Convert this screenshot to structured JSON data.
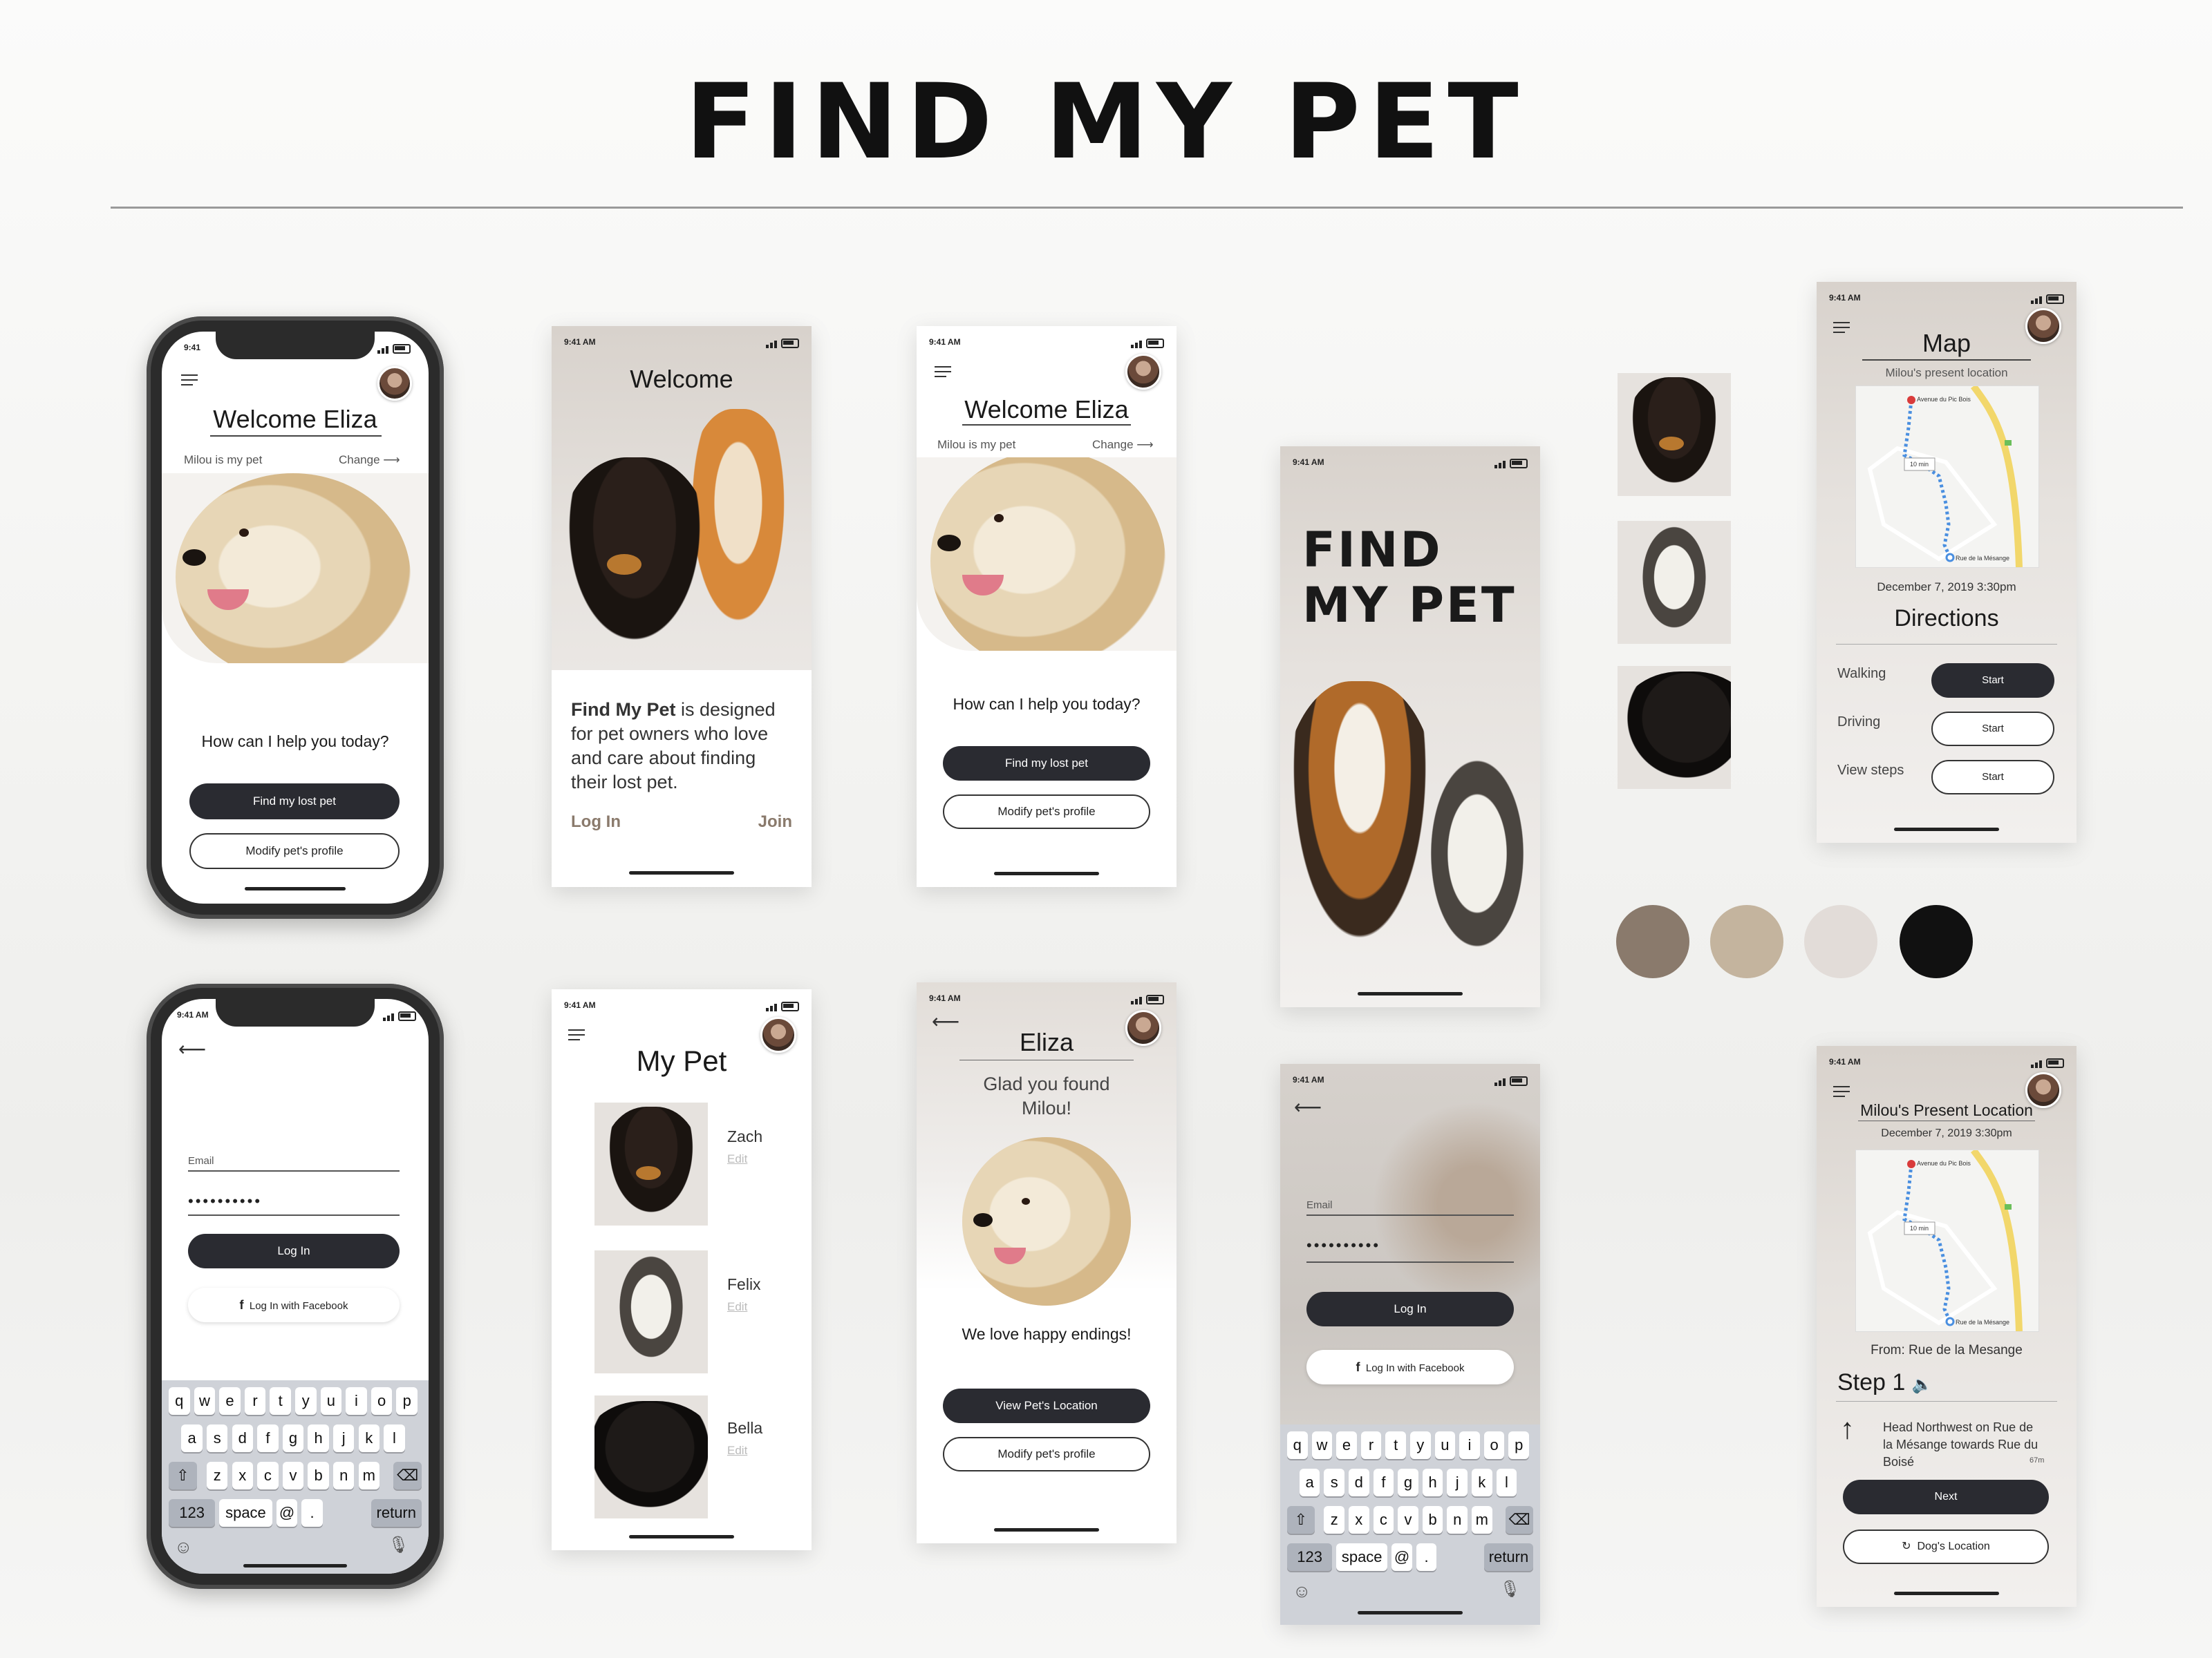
{
  "title": "FIND MY PET",
  "status_time": "9:41",
  "status_time_am": "9:41 AM",
  "home": {
    "welcome": "Welcome Eliza",
    "pet_line": "Milou is my pet",
    "change": "Change",
    "question": "How can I help you today?",
    "find_btn": "Find my lost pet",
    "modify_btn": "Modify pet's profile"
  },
  "welcome_screen": {
    "title": "Welcome",
    "brand": "Find My Pet",
    "desc": " is designed for pet owners who love and care about finding their lost pet.",
    "login": "Log In",
    "join": "Join"
  },
  "splash": {
    "line1": "FIND",
    "line2": "MY PET"
  },
  "login": {
    "email_label": "Email",
    "password_mask": "••••••••••",
    "login_btn": "Log In",
    "facebook_btn": "Log In with Facebook"
  },
  "keyboard": {
    "row1": [
      "q",
      "w",
      "e",
      "r",
      "t",
      "y",
      "u",
      "i",
      "o",
      "p"
    ],
    "row2": [
      "a",
      "s",
      "d",
      "f",
      "g",
      "h",
      "j",
      "k",
      "l"
    ],
    "row3": [
      "z",
      "x",
      "c",
      "v",
      "b",
      "n",
      "m"
    ],
    "num": "123",
    "space": "space",
    "at": "@",
    "dot": ".",
    "ret": "return"
  },
  "my_pet": {
    "title": "My Pet",
    "pets": [
      {
        "name": "Zach",
        "edit": "Edit"
      },
      {
        "name": "Felix",
        "edit": "Edit"
      },
      {
        "name": "Bella",
        "edit": "Edit"
      }
    ]
  },
  "found": {
    "name": "Eliza",
    "msg": "Glad you found Milou!",
    "love": "We love happy endings!",
    "view_btn": "View Pet's Location",
    "modify_btn": "Modify pet's profile"
  },
  "map_screen": {
    "title": "Map",
    "subtitle": "Milou's present location",
    "date": "December 7, 2019   3:30pm",
    "directions": "Directions",
    "modes": [
      "Walking",
      "Driving",
      "View steps"
    ],
    "start": "Start",
    "map_label_top": "Avenue du Pic Bois",
    "map_label_bottom": "Rue de la Mésange",
    "map_eta": "10 min"
  },
  "step_screen": {
    "title": "Milou's Present Location",
    "date": "December 7, 2019   3:30pm",
    "from": "From: Rue de la Mesange",
    "step": "Step 1",
    "instruction": "Head Northwest on Rue de la Mésange towards Rue du Boisé",
    "distance": "67m",
    "next_btn": "Next",
    "dog_btn": "Dog's Location"
  },
  "palette": [
    "#8a7a6c",
    "#c4b49e",
    "#e2dcd8",
    "#111111"
  ]
}
